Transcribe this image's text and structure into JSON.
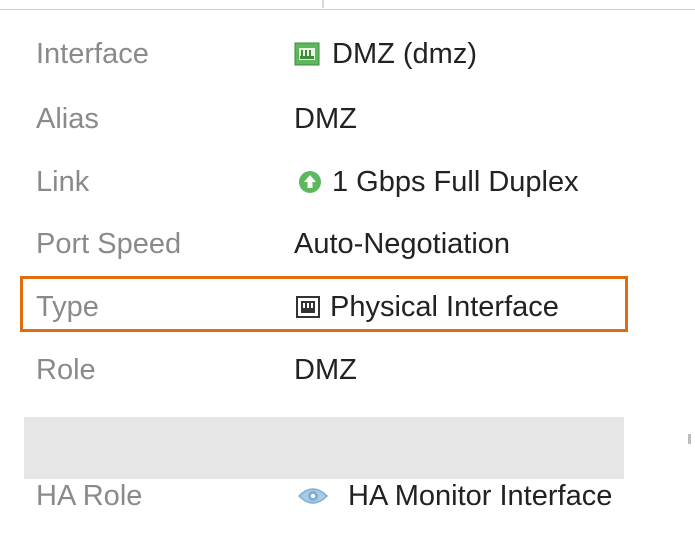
{
  "properties": [
    {
      "label": "Interface",
      "value": "DMZ (dmz)",
      "icon": "network-port-icon",
      "icon_color": "#5cb85c"
    },
    {
      "label": "Alias",
      "value": "DMZ"
    },
    {
      "label": "Link",
      "value": "1 Gbps Full Duplex",
      "icon": "link-up-arrow-icon",
      "icon_color": "#5cb85c"
    },
    {
      "label": "Port Speed",
      "value": "Auto-Negotiation"
    },
    {
      "label": "Type",
      "value": "Physical Interface",
      "icon": "physical-port-icon",
      "icon_color": "#333333"
    },
    {
      "label": "Role",
      "value": "DMZ"
    },
    {
      "label": "HA Role",
      "value": "HA Monitor Interface",
      "icon": "eye-icon",
      "icon_color": "#7aaed6"
    }
  ],
  "colors": {
    "highlight_border": "#e26b10",
    "label_text": "#8a8a8a",
    "value_text": "#222222",
    "redaction_block": "#e6e6e6"
  }
}
